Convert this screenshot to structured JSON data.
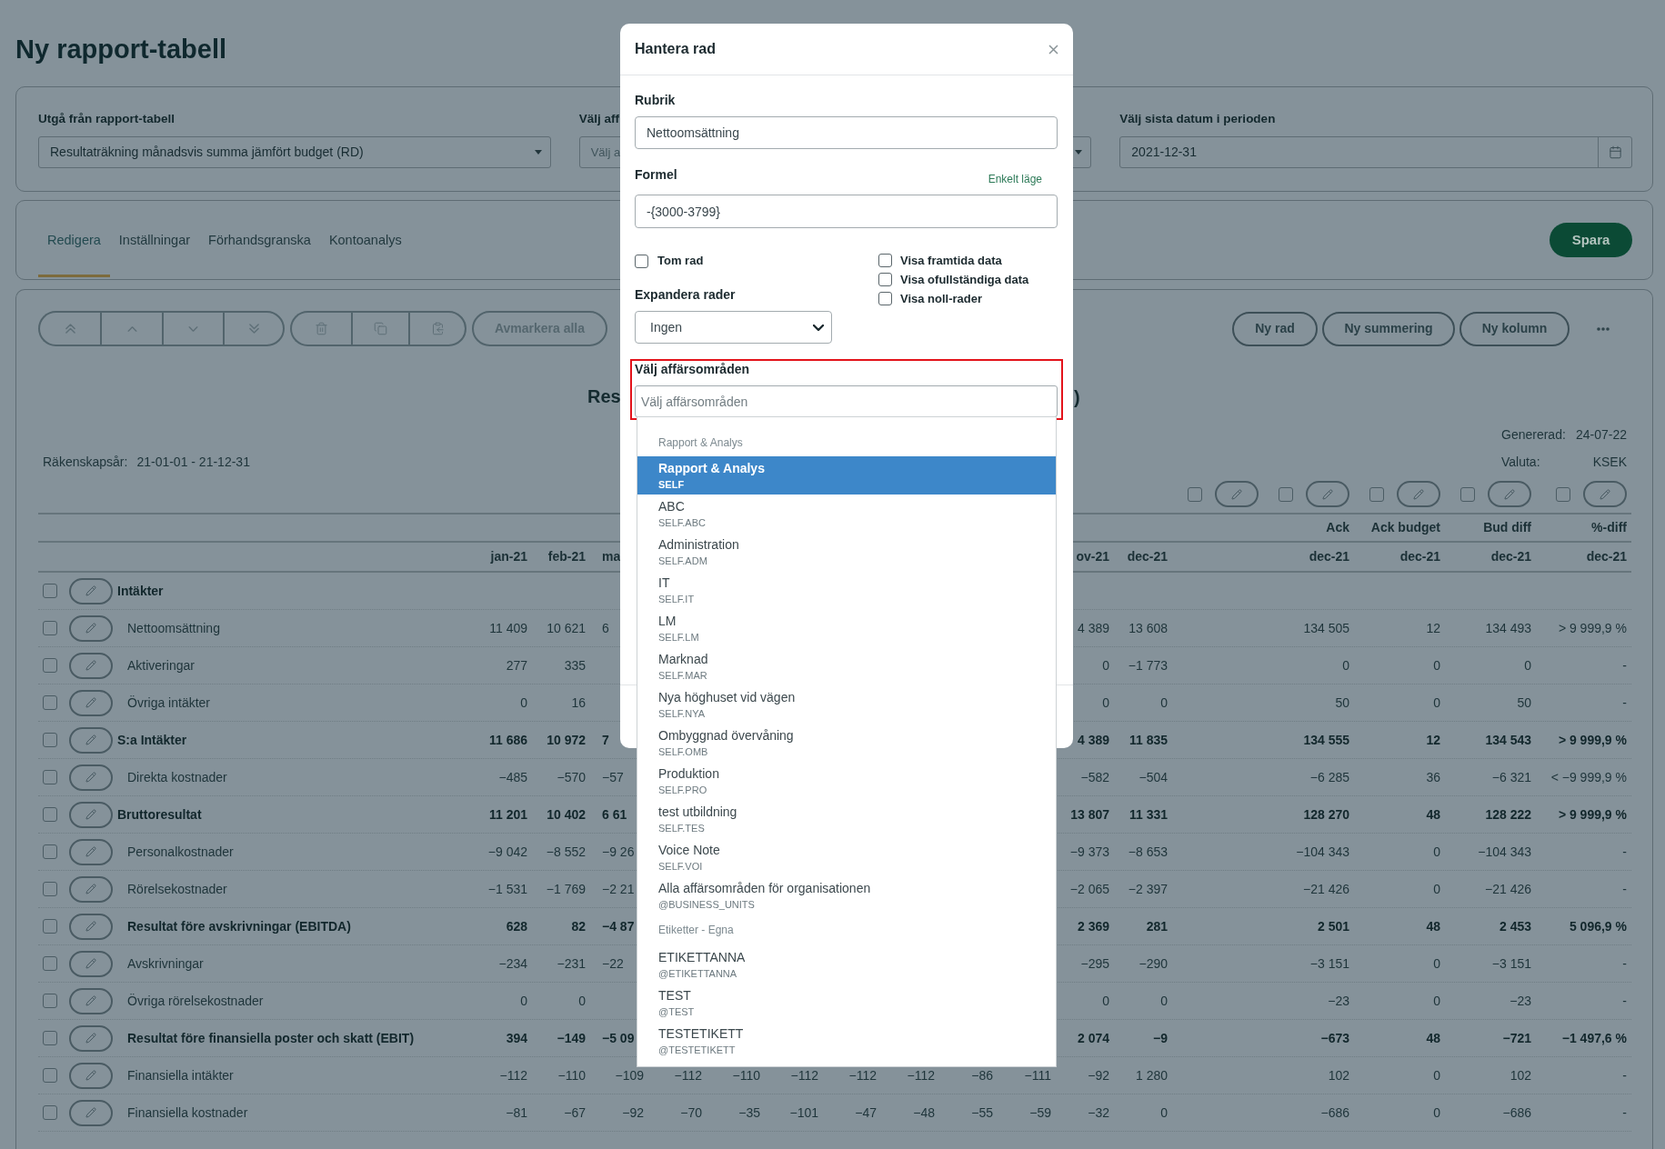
{
  "page": {
    "title": "Ny rapport-tabell"
  },
  "filters": [
    {
      "kind": "select",
      "label": "Utgå från rapport-tabell",
      "value": "Resultaträkning månadsvis summa jämfört budget (RD)"
    },
    {
      "kind": "select",
      "label": "Välj aff",
      "placeholder": "Välj a"
    },
    {
      "kind": "date",
      "label": "Välj sista datum i perioden",
      "value": "2021-12-31"
    }
  ],
  "tabs": [
    {
      "label": "Redigera",
      "selected": true
    },
    {
      "label": "Inställningar",
      "selected": false
    },
    {
      "label": "Förhandsgranska",
      "selected": false
    },
    {
      "label": "Kontoanalys",
      "selected": false
    }
  ],
  "save_button": "Spara",
  "toolbar": {
    "button_groups": [
      {
        "buttons": [
          {
            "kind": "to_top",
            "disabled": true
          },
          {
            "kind": "up",
            "disabled": true
          },
          {
            "kind": "down",
            "disabled": true
          },
          {
            "kind": "to_bottom",
            "disabled": true
          }
        ]
      },
      {
        "buttons": [
          {
            "kind": "delete",
            "disabled": true
          },
          {
            "kind": "copy",
            "disabled": true
          },
          {
            "kind": "paste",
            "disabled": true
          }
        ]
      }
    ],
    "deselect_button": {
      "label": "Avmarkera alla",
      "disabled": true
    },
    "actions": [
      {
        "label": "Ny rad"
      },
      {
        "label": "Ny summering"
      },
      {
        "label": "Ny kolumn"
      }
    ]
  },
  "report": {
    "title_parts": [
      "Res",
      ")"
    ],
    "generated": {
      "label": "Genererad:",
      "value": "24-07-22"
    },
    "fiscal_year": {
      "label": "Räkenskapsår:",
      "value": "21-01-01 - 21-12-31"
    },
    "currency": {
      "label": "Valuta:",
      "value": "KSEK"
    }
  },
  "table": {
    "column_controls": {
      "column_13": {
        "checked": false
      },
      "column_14": {
        "checked": false
      },
      "column_15": {
        "checked": false
      },
      "column_16": {
        "checked": false
      },
      "column_17": {
        "checked": false
      }
    },
    "top_headers": {
      "column_14": "Ack",
      "column_15": "Ack budget",
      "column_16": "Bud diff",
      "column_17": "%-diff"
    },
    "column_headers": {
      "column_1": "jan-21",
      "column_2": "feb-21",
      "column_3": "ma",
      "column_11": "ov-21",
      "column_12": "dec-21",
      "column_14": "dec-21",
      "column_15": "dec-21",
      "column_16": "dec-21",
      "column_17": "dec-21"
    },
    "rows": [
      {
        "label": "Intäkter",
        "kind": "group",
        "checked": false
      },
      {
        "label": "Nettoomsättning",
        "kind": "line",
        "checked": false,
        "values": {
          "column_1": "11 409",
          "column_2": "10 621",
          "column_3": "6",
          "column_11": "4 389",
          "column_12": "13 608",
          "column_14": "134 505",
          "column_15": "12",
          "column_16": "134 493",
          "column_17": "> 9 999,9 %"
        }
      },
      {
        "label": "Aktiveringar",
        "kind": "line",
        "checked": false,
        "values": {
          "column_1": "277",
          "column_2": "335",
          "column_11": "0",
          "column_12": "−1 773",
          "column_14": "0",
          "column_15": "0",
          "column_16": "0",
          "column_17": "-"
        }
      },
      {
        "label": "Övriga intäkter",
        "kind": "line",
        "checked": false,
        "values": {
          "column_1": "0",
          "column_2": "16",
          "column_11": "0",
          "column_12": "0",
          "column_14": "50",
          "column_15": "0",
          "column_16": "50",
          "column_17": "-"
        }
      },
      {
        "label": "S:a Intäkter",
        "kind": "group",
        "checked": false,
        "values": {
          "column_1": "11 686",
          "column_2": "10 972",
          "column_3": "7",
          "column_11": "4 389",
          "column_12": "11 835",
          "column_14": "134 555",
          "column_15": "12",
          "column_16": "134 543",
          "column_17": "> 9 999,9 %"
        }
      },
      {
        "label": "Direkta kostnader",
        "kind": "line",
        "checked": false,
        "values": {
          "column_1": "−485",
          "column_2": "−570",
          "column_3": "−57",
          "column_11": "−582",
          "column_12": "−504",
          "column_14": "−6 285",
          "column_15": "36",
          "column_16": "−6 321",
          "column_17": "< −9 999,9 %"
        }
      },
      {
        "label": "Bruttoresultat",
        "kind": "group",
        "checked": false,
        "values": {
          "column_1": "11 201",
          "column_2": "10 402",
          "column_3": "6 61",
          "column_11": "13 807",
          "column_12": "11 331",
          "column_14": "128 270",
          "column_15": "48",
          "column_16": "128 222",
          "column_17": "> 9 999,9 %"
        }
      },
      {
        "label": "Personalkostnader",
        "kind": "line",
        "checked": false,
        "values": {
          "column_1": "−9 042",
          "column_2": "−8 552",
          "column_3": "−9 26",
          "column_11": "−9 373",
          "column_12": "−8 653",
          "column_14": "−104 343",
          "column_15": "0",
          "column_16": "−104 343",
          "column_17": "-"
        }
      },
      {
        "label": "Rörelsekostnader",
        "kind": "line",
        "checked": false,
        "values": {
          "column_1": "−1 531",
          "column_2": "−1 769",
          "column_3": "−2 21",
          "column_11": "−2 065",
          "column_12": "−2 397",
          "column_14": "−21 426",
          "column_15": "0",
          "column_16": "−21 426",
          "column_17": "-"
        }
      },
      {
        "label": "Resultat före avskrivningar (EBITDA)",
        "kind": "total",
        "checked": false,
        "values": {
          "column_1": "628",
          "column_2": "82",
          "column_3": "−4 87",
          "column_11": "2 369",
          "column_12": "281",
          "column_14": "2 501",
          "column_15": "48",
          "column_16": "2 453",
          "column_17": "5 096,9 %"
        }
      },
      {
        "label": "Avskrivningar",
        "kind": "line",
        "checked": false,
        "values": {
          "column_1": "−234",
          "column_2": "−231",
          "column_3": "−22",
          "column_11": "−295",
          "column_12": "−290",
          "column_14": "−3 151",
          "column_15": "0",
          "column_16": "−3 151",
          "column_17": "-"
        }
      },
      {
        "label": "Övriga rörelsekostnader",
        "kind": "line",
        "checked": false,
        "values": {
          "column_1": "0",
          "column_2": "0",
          "column_11": "0",
          "column_12": "0",
          "column_14": "−23",
          "column_15": "0",
          "column_16": "−23",
          "column_17": "-"
        }
      },
      {
        "label": "Resultat före finansiella poster och skatt (EBIT)",
        "kind": "total",
        "checked": false,
        "values": {
          "column_1": "394",
          "column_2": "−149",
          "column_3": "−5 09",
          "column_11": "2 074",
          "column_12": "−9",
          "column_14": "−673",
          "column_15": "48",
          "column_16": "−721",
          "column_17": "−1 497,6 %"
        }
      },
      {
        "label": "Finansiella intäkter",
        "kind": "line",
        "checked": false,
        "values": {
          "column_1": "−112",
          "column_2": "−110",
          "column_3": "−109",
          "column_4": "−112",
          "column_5": "−110",
          "column_6": "−112",
          "column_7": "−112",
          "column_8": "−112",
          "column_9": "−86",
          "column_10": "−111",
          "column_11": "−92",
          "column_12": "1 280",
          "column_14": "102",
          "column_15": "0",
          "column_16": "102",
          "column_17": "-"
        }
      },
      {
        "label": "Finansiella kostnader",
        "kind": "line",
        "checked": false,
        "values": {
          "column_1": "−81",
          "column_2": "−67",
          "column_3": "−92",
          "column_4": "−70",
          "column_5": "−35",
          "column_6": "−101",
          "column_7": "−47",
          "column_8": "−48",
          "column_9": "−55",
          "column_10": "−59",
          "column_11": "−32",
          "column_12": "0",
          "column_14": "−686",
          "column_15": "0",
          "column_16": "−686",
          "column_17": "-"
        }
      }
    ]
  },
  "modal": {
    "title": "Hantera rad",
    "heading": {
      "label": "Rubrik",
      "value": "Nettoomsättning"
    },
    "formula": {
      "label": "Formel",
      "link": "Enkelt läge",
      "value": "-{3000-3799}"
    },
    "left_options": [
      {
        "label": "Tom rad",
        "checked": false
      }
    ],
    "expand_rows": {
      "label": "Expandera rader",
      "value": "Ingen"
    },
    "right_options": [
      {
        "label": "Visa framtida data",
        "checked": false
      },
      {
        "label": "Visa ofullständiga data",
        "checked": false
      },
      {
        "label": "Visa noll-rader",
        "checked": false
      }
    ],
    "business_areas": {
      "label": "Välj affärsområden",
      "placeholder": "Välj affärsområden",
      "highlighted": true,
      "option_groups": [
        {
          "label": "Rapport & Analys",
          "options": [
            {
              "name": "Rapport & Analys",
              "code": "SELF",
              "selected": true
            },
            {
              "name": "ABC",
              "code": "SELF.ABC",
              "selected": false
            },
            {
              "name": "Administration",
              "code": "SELF.ADM",
              "selected": false
            },
            {
              "name": "IT",
              "code": "SELF.IT",
              "selected": false
            },
            {
              "name": "LM",
              "code": "SELF.LM",
              "selected": false
            },
            {
              "name": "Marknad",
              "code": "SELF.MAR",
              "selected": false
            },
            {
              "name": "Nya höghuset vid vägen",
              "code": "SELF.NYA",
              "selected": false
            },
            {
              "name": "Ombyggnad övervåning",
              "code": "SELF.OMB",
              "selected": false
            },
            {
              "name": "Produktion",
              "code": "SELF.PRO",
              "selected": false
            },
            {
              "name": "test utbildning",
              "code": "SELF.TES",
              "selected": false
            },
            {
              "name": "Voice Note",
              "code": "SELF.VOI",
              "selected": false
            },
            {
              "name": "Alla affärsområden för organisationen",
              "code": "@BUSINESS_UNITS",
              "selected": false
            }
          ]
        },
        {
          "label": "Etiketter - Egna",
          "options": [
            {
              "name": "ETIKETTANNA",
              "code": "@ETIKETTANNA",
              "selected": false
            },
            {
              "name": "TEST",
              "code": "@TEST",
              "selected": false
            },
            {
              "name": "TESTETIKETT",
              "code": "@TESTETIKETT",
              "selected": false
            }
          ]
        }
      ]
    }
  }
}
